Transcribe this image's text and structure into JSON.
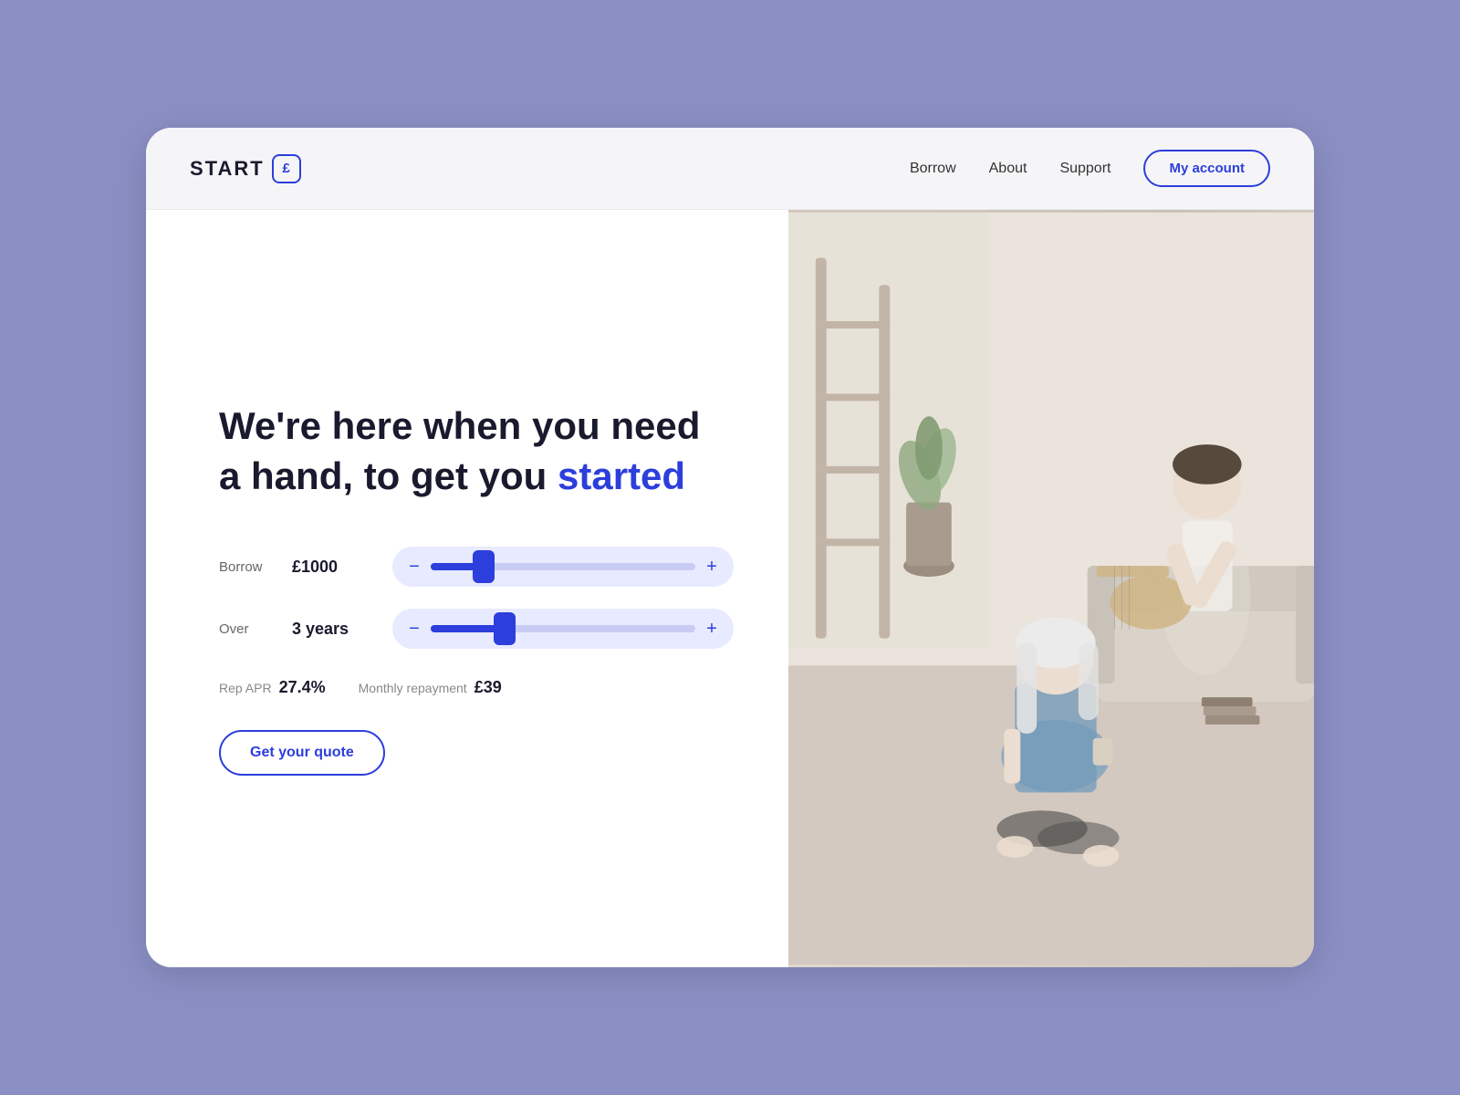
{
  "page": {
    "background_color": "#8b8fc4"
  },
  "navbar": {
    "logo_text": "START",
    "logo_icon": "£",
    "nav_links": [
      {
        "label": "Borrow",
        "id": "borrow"
      },
      {
        "label": "About",
        "id": "about"
      },
      {
        "label": "Support",
        "id": "support"
      }
    ],
    "my_account_label": "My account"
  },
  "hero": {
    "headline_part1": "We're here when you need",
    "headline_part2": "a hand, to get you ",
    "headline_accent": "started",
    "borrow_label": "Borrow",
    "borrow_value": "£1000",
    "over_label": "Over",
    "over_value": "3 years",
    "rep_apr_label": "Rep APR",
    "rep_apr_value": "27.4%",
    "monthly_repayment_label": "Monthly repayment",
    "monthly_repayment_value": "£39",
    "cta_label": "Get your quote",
    "minus_label": "−",
    "plus_label": "+"
  }
}
